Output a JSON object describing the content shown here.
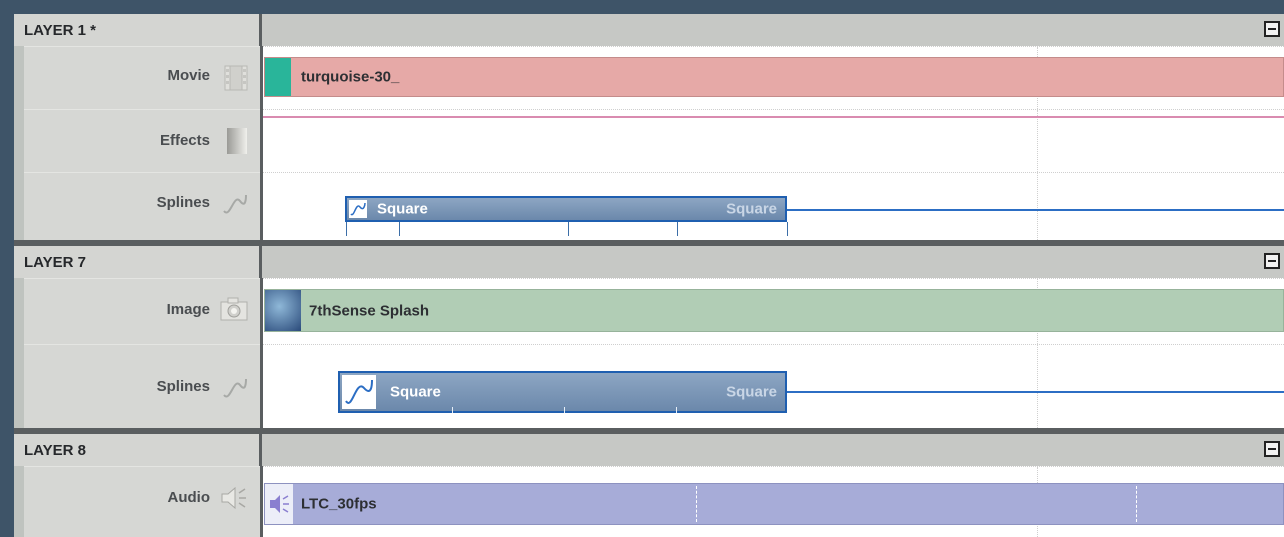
{
  "layers": [
    {
      "title": "LAYER 1 *",
      "rows": [
        {
          "label": "Movie",
          "icon": "film-icon",
          "clip": "turquoise-30_"
        },
        {
          "label": "Effects",
          "icon": "effects-icon"
        },
        {
          "label": "Splines",
          "icon": "spline-curve-icon",
          "clip": "Square",
          "clip_end": "Square"
        }
      ]
    },
    {
      "title": "LAYER 7",
      "rows": [
        {
          "label": "Image",
          "icon": "camera-icon",
          "clip": "7thSense Splash"
        },
        {
          "label": "Splines",
          "icon": "spline-curve-icon",
          "clip": "Square",
          "clip_end": "Square"
        }
      ]
    },
    {
      "title": "LAYER 8",
      "rows": [
        {
          "label": "Audio",
          "icon": "speaker-icon",
          "clip": "LTC_30fps"
        }
      ]
    }
  ],
  "colors": {
    "movie_clip": "#e6a9a7",
    "image_clip": "#b1cdb5",
    "audio_clip": "#a7acd8",
    "spline_clip": "#7896b8",
    "spline_line": "#2c6ec4"
  }
}
